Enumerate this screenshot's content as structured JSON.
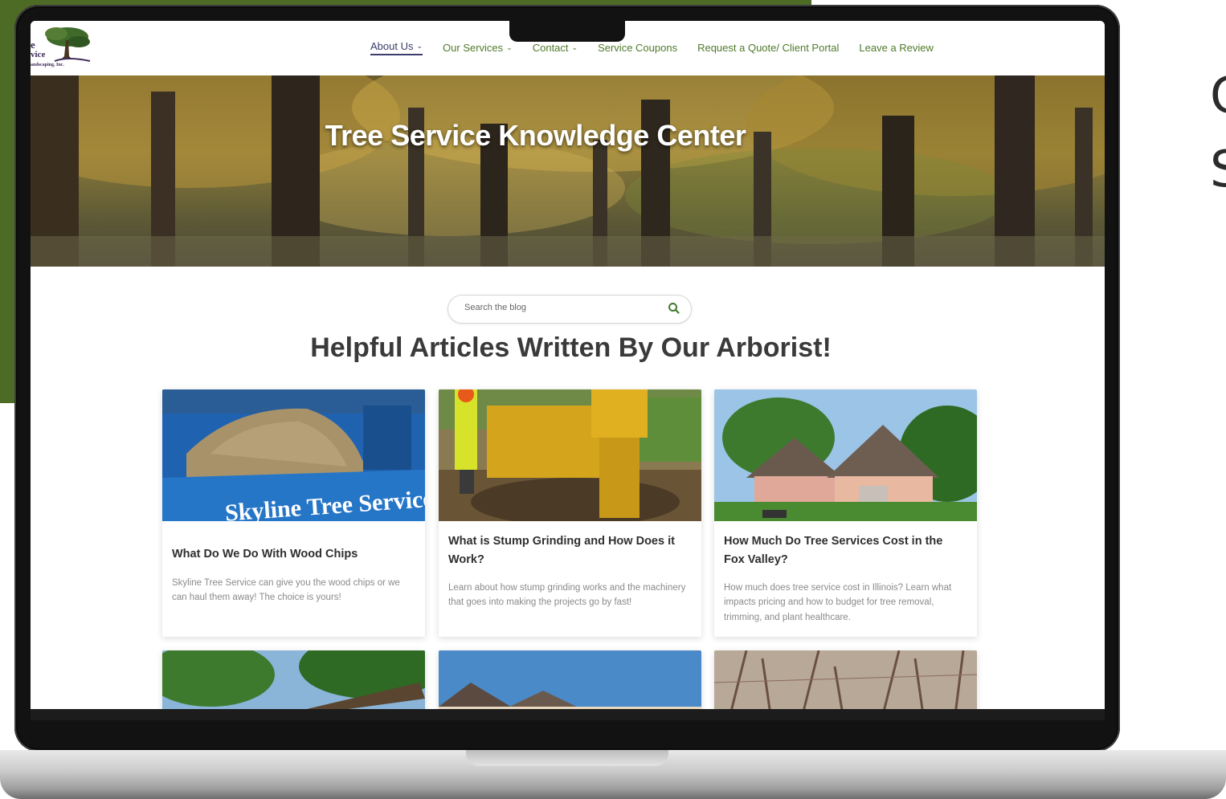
{
  "side_text": {
    "line1": "C",
    "line2": "S"
  },
  "logo": {
    "line1": "e",
    "line2": "vice",
    "line3": "andscaping, Inc."
  },
  "nav": [
    {
      "label": "About Us",
      "dropdown": true,
      "active": true
    },
    {
      "label": "Our Services",
      "dropdown": true
    },
    {
      "label": "Contact",
      "dropdown": true
    },
    {
      "label": "Service Coupons"
    },
    {
      "label": "Request a Quote/ Client Portal"
    },
    {
      "label": "Leave a Review"
    }
  ],
  "hero": {
    "title": "Tree Service Knowledge Center"
  },
  "search": {
    "placeholder": "Search the blog"
  },
  "section": {
    "title": "Helpful Articles Written By Our Arborist!"
  },
  "cards": [
    {
      "title": "What Do We Do With Wood Chips",
      "excerpt": "Skyline Tree Service can give you the wood chips or we can haul them away! The choice is yours!",
      "image_text": "Skyline Tree Service"
    },
    {
      "title": "What is Stump Grinding and How Does it Work?",
      "excerpt": "Learn about how stump grinding works and the machinery that goes into making the projects go by fast!"
    },
    {
      "title": "How Much Do Tree Services Cost in the Fox Valley?",
      "excerpt": "How much does tree service cost in Illinois? Learn what impacts pricing and how to budget for tree removal, trimming, and plant healthcare."
    }
  ],
  "colors": {
    "brand_green": "#4e6b26",
    "nav_green": "#4f7a2a",
    "nav_active": "#3c3c6e",
    "heading": "#3a3a3a"
  }
}
